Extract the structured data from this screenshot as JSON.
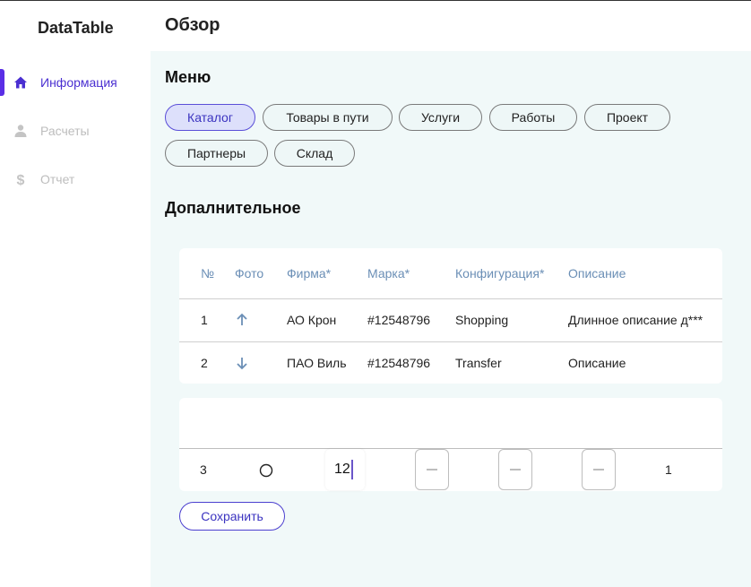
{
  "app": {
    "brand": "DataTable"
  },
  "sidebar": {
    "items": [
      {
        "label": "Информация",
        "icon": "home-icon",
        "active": true
      },
      {
        "label": "Расчеты",
        "icon": "person-icon",
        "active": false
      },
      {
        "label": "Отчет",
        "icon": "dollar-icon",
        "active": false
      }
    ]
  },
  "header": {
    "title": "Обзор"
  },
  "menu": {
    "title": "Меню",
    "chips": [
      "Каталог",
      "Товары в пути",
      "Услуги",
      "Работы",
      "Проект",
      "Партнеры",
      "Склад"
    ],
    "active_chip": "Каталог"
  },
  "extra": {
    "title": "Допалнительное",
    "table": {
      "columns": [
        "№",
        "Фото",
        "Фирма*",
        "Марка*",
        "Конфигурация*",
        "Описание"
      ],
      "rows": [
        {
          "num": "1",
          "photo_icon": "arrow-up-icon",
          "firm": "АО Крон",
          "mark": "#12548796",
          "config": "Shopping",
          "desc": "Длинное описание д***"
        },
        {
          "num": "2",
          "photo_icon": "arrow-down-icon",
          "firm": "ПАО Виль",
          "mark": "#12548796",
          "config": "Transfer",
          "desc": "Описание"
        }
      ]
    },
    "edit_row": {
      "num": "3",
      "radio_icon": "radio-empty-icon",
      "input_value": "12",
      "count": "1"
    }
  },
  "actions": {
    "save_label": "Сохранить"
  },
  "colors": {
    "accent": "#5a2ee6",
    "main_bg": "#f1f9f9",
    "header_text": "#6b8fb6"
  }
}
